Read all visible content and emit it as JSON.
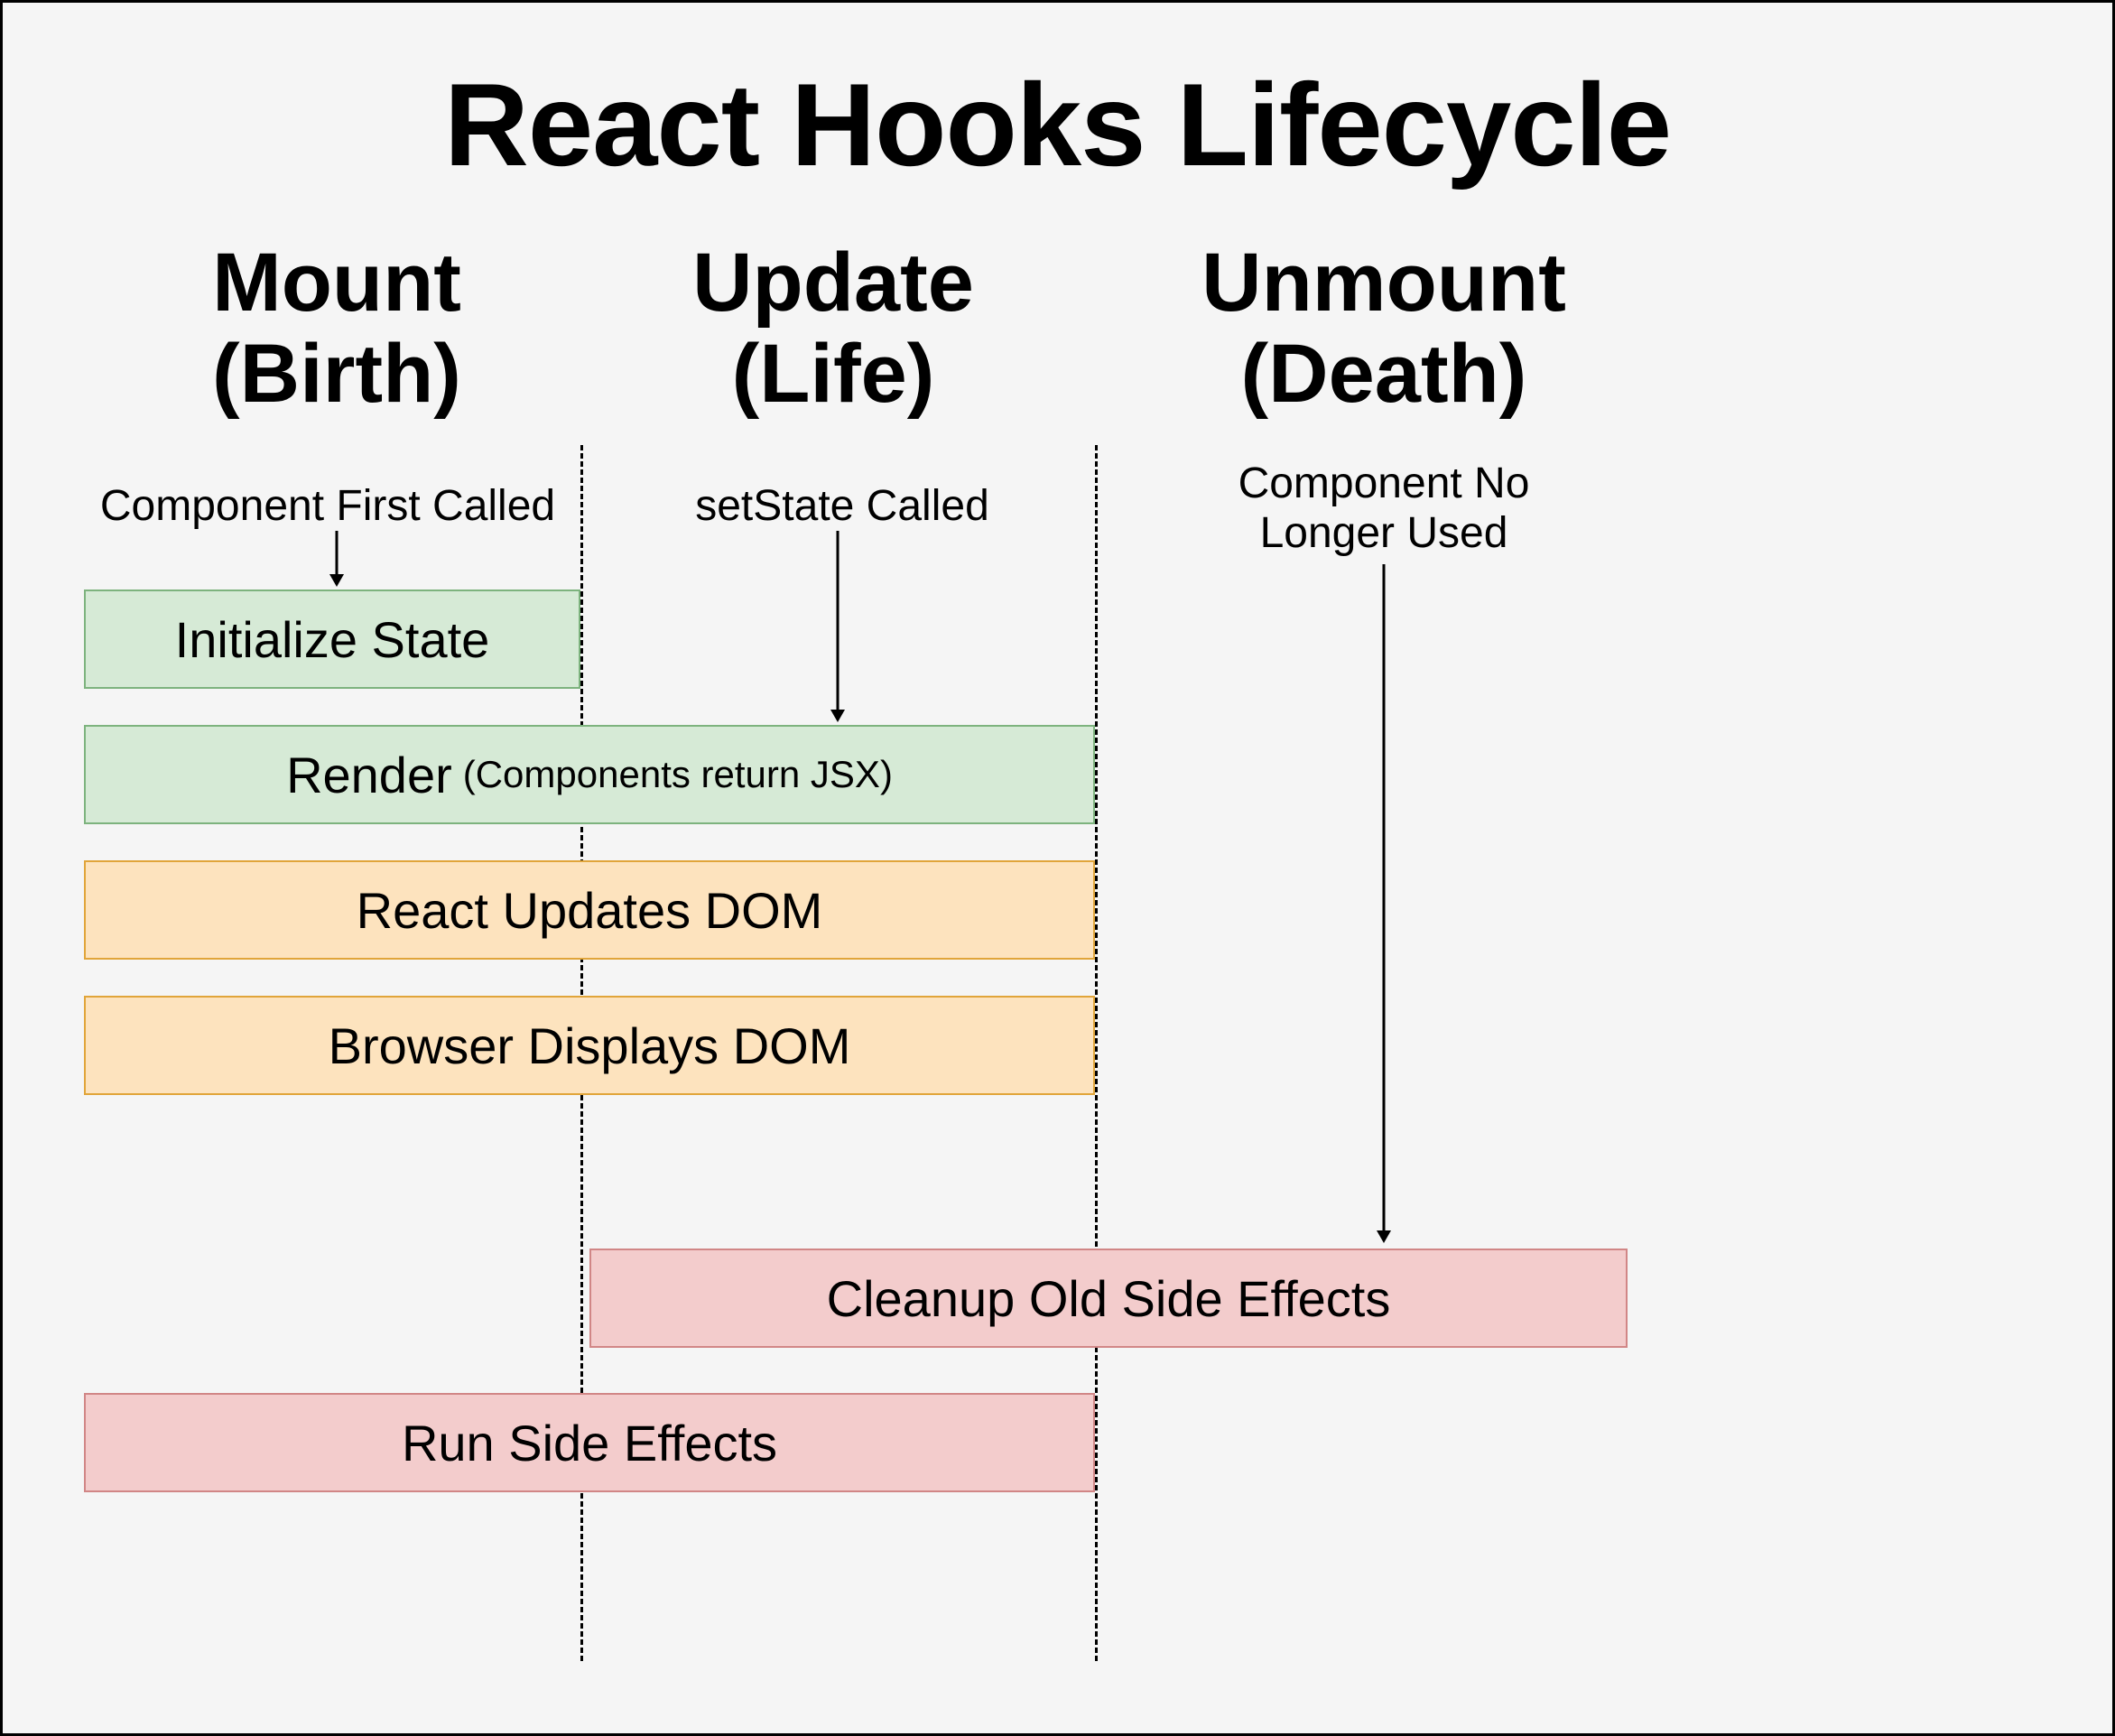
{
  "title": "React Hooks Lifecycle",
  "columns": {
    "mount": {
      "line1": "Mount",
      "line2": "(Birth)"
    },
    "update": {
      "line1": "Update",
      "line2": "(Life)"
    },
    "unmount": {
      "line1": "Unmount",
      "line2": "(Death)"
    }
  },
  "triggers": {
    "mount": "Component First Called",
    "update": "setState Called",
    "unmount": {
      "line1": "Component No",
      "line2": "Longer Used"
    }
  },
  "boxes": {
    "initState": "Initialize State",
    "render": {
      "main": "Render",
      "sub": "(Components return JSX)"
    },
    "reactUpdatesDom": "React Updates DOM",
    "browserDisplays": "Browser Displays DOM",
    "cleanup": "Cleanup Old Side Effects",
    "runEffects": "Run Side Effects"
  },
  "layout": {
    "col_x": {
      "mount_center": 370,
      "update_center": 920,
      "unmount_center": 1510
    },
    "divider_x": [
      640,
      1210
    ],
    "colors": {
      "green": "#d6ead6",
      "orange": "#fde3be",
      "red": "#f3cccc"
    }
  }
}
